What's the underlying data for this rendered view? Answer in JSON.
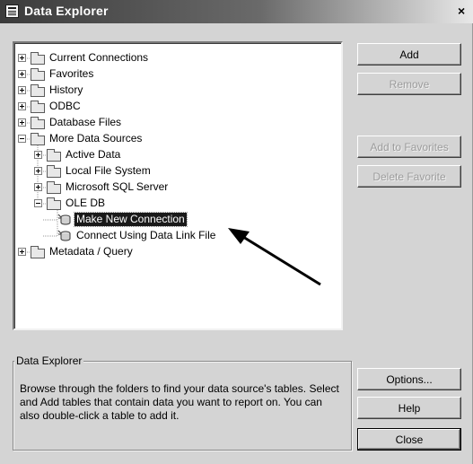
{
  "window": {
    "title": "Data Explorer",
    "close_glyph": "×"
  },
  "tree": {
    "items": [
      {
        "label": "Current Connections",
        "level": 0,
        "expander": "plus",
        "icon": "folder-icon"
      },
      {
        "label": "Favorites",
        "level": 0,
        "expander": "plus",
        "icon": "folder-icon"
      },
      {
        "label": "History",
        "level": 0,
        "expander": "plus",
        "icon": "folder-icon"
      },
      {
        "label": "ODBC",
        "level": 0,
        "expander": "plus",
        "icon": "folder-icon"
      },
      {
        "label": "Database Files",
        "level": 0,
        "expander": "plus",
        "icon": "folder-icon"
      },
      {
        "label": "More Data Sources",
        "level": 0,
        "expander": "minus",
        "icon": "folder-icon"
      },
      {
        "label": "Active Data",
        "level": 1,
        "expander": "plus",
        "icon": "folder-icon"
      },
      {
        "label": "Local File System",
        "level": 1,
        "expander": "plus",
        "icon": "folder-icon"
      },
      {
        "label": "Microsoft SQL Server",
        "level": 1,
        "expander": "plus",
        "icon": "folder-icon"
      },
      {
        "label": "OLE DB",
        "level": 1,
        "expander": "minus",
        "icon": "folder-icon"
      },
      {
        "label": "Make New Connection",
        "level": 2,
        "expander": "none",
        "icon": "new-connection-icon",
        "selected": true
      },
      {
        "label": "Connect Using Data Link File",
        "level": 2,
        "expander": "none",
        "icon": "data-link-icon"
      },
      {
        "label": "Metadata / Query",
        "level": 0,
        "expander": "plus",
        "icon": "folder-icon"
      }
    ]
  },
  "buttons": {
    "add": "Add",
    "remove": "Remove",
    "add_to_favorites": "Add to Favorites",
    "delete_favorite": "Delete Favorite",
    "options": "Options...",
    "help": "Help",
    "close": "Close"
  },
  "info": {
    "legend": "Data Explorer",
    "text": "Browse through the folders to find your data source's tables. Select and Add tables that contain data you want to report on. You can also double-click a table to add it."
  },
  "colors": {
    "dialog_background": "#d4d4d4",
    "selection_background": "#1a1a1a",
    "disabled_text": "#9c9c9c"
  }
}
